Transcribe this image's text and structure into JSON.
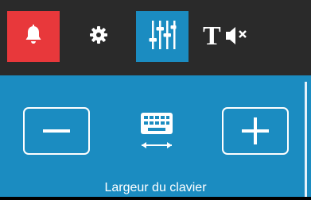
{
  "toolbar": {
    "buttons": [
      {
        "name": "notifications",
        "icon": "bell-icon",
        "active": true,
        "color": "#e8383b"
      },
      {
        "name": "settings",
        "icon": "gear-icon",
        "active": false
      },
      {
        "name": "sliders",
        "icon": "sliders-icon",
        "active": true,
        "color": "#1b8cc1"
      },
      {
        "name": "text-mute",
        "icon": "text-mute-icon",
        "glyph": "T",
        "active": false
      }
    ],
    "background": "#2a2a2a"
  },
  "panel": {
    "background": "#1b8cc1",
    "minus_icon": "minus-icon",
    "keyboard_icon": "keyboard-width-icon",
    "plus_icon": "plus-icon",
    "label": "Largeur du clavier"
  }
}
